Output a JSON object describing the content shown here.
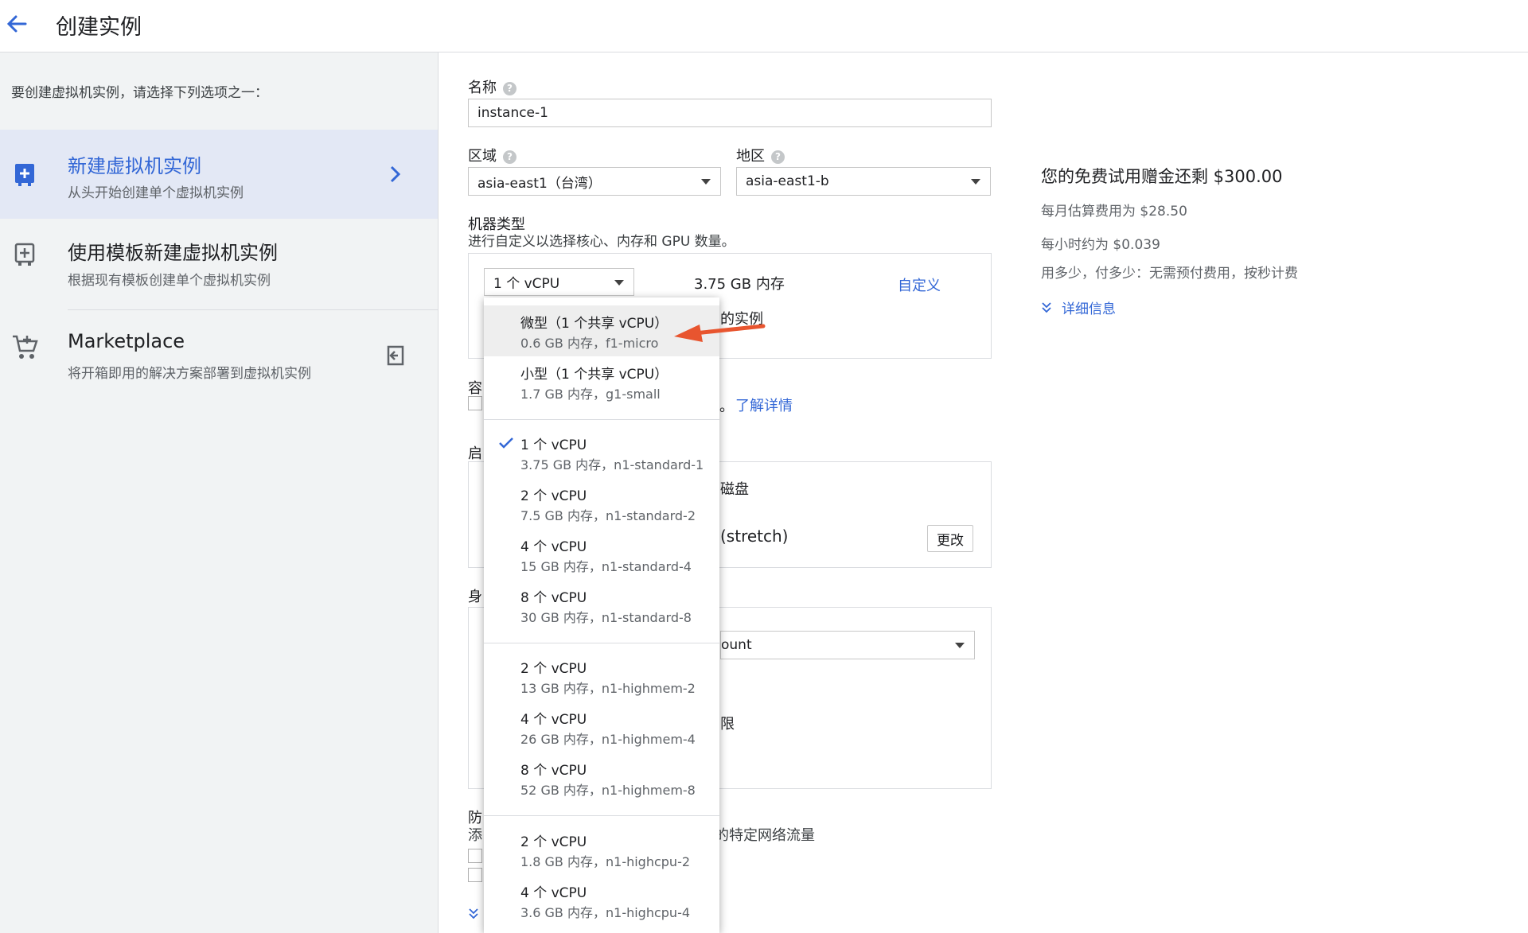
{
  "header": {
    "title": "创建实例",
    "back_icon": "arrow-back-icon"
  },
  "sidebar": {
    "intro": "要创建虚拟机实例，请选择下列选项之一：",
    "options": [
      {
        "title": "新建虚拟机实例",
        "subtitle": "从头开始创建单个虚拟机实例",
        "icon": "add-instance-icon",
        "selected": true
      },
      {
        "title": "使用模板新建虚拟机实例",
        "subtitle": "根据现有模板创建单个虚拟机实例",
        "icon": "add-template-icon",
        "selected": false
      },
      {
        "title": "Marketplace",
        "subtitle": "将开箱即用的解决方案部署到虚拟机实例",
        "icon": "cart-icon",
        "selected": false
      }
    ]
  },
  "form": {
    "name": {
      "label": "名称",
      "value": "instance-1"
    },
    "region": {
      "label": "区域",
      "value": "asia-east1（台湾）"
    },
    "zone": {
      "label": "地区",
      "value": "asia-east1-b"
    },
    "machine_type": {
      "label": "机器类型",
      "hint": "进行自定义以选择核心、内存和 GPU 数量。",
      "selected": "1 个 vCPU",
      "memory": "3.75 GB 内存",
      "customize": "自定义",
      "partial_text": "的实例"
    },
    "frag_container": "容",
    "frag_learn_prefix": "。",
    "learn_more": "了解详情",
    "frag_boot": "启",
    "frag_disk": "磁盘",
    "frag_stretch": "(stretch)",
    "change_button": "更改",
    "frag_identity": "身",
    "frag_account": "ount",
    "frag_limit": "限",
    "frag_firewall": "防",
    "frag_add": "添",
    "frag_traffic": "的特定网络流量"
  },
  "dropdown": {
    "items": [
      {
        "title": "微型（1 个共享 vCPU）",
        "subtitle": "0.6 GB 内存，f1-micro",
        "highlighted": true
      },
      {
        "title": "小型（1 个共享 vCPU）",
        "subtitle": "1.7 GB 内存，g1-small"
      },
      {
        "title": "1 个 vCPU",
        "subtitle": "3.75 GB 内存，n1-standard-1",
        "checked": true
      },
      {
        "title": "2 个 vCPU",
        "subtitle": "7.5 GB 内存，n1-standard-2"
      },
      {
        "title": "4 个 vCPU",
        "subtitle": "15 GB 内存，n1-standard-4"
      },
      {
        "title": "8 个 vCPU",
        "subtitle": "30 GB 内存，n1-standard-8"
      },
      {
        "title": "2 个 vCPU",
        "subtitle": "13 GB 内存，n1-highmem-2"
      },
      {
        "title": "4 个 vCPU",
        "subtitle": "26 GB 内存，n1-highmem-4"
      },
      {
        "title": "8 个 vCPU",
        "subtitle": "52 GB 内存，n1-highmem-8"
      },
      {
        "title": "2 个 vCPU",
        "subtitle": "1.8 GB 内存，n1-highcpu-2"
      },
      {
        "title": "4 个 vCPU",
        "subtitle": "3.6 GB 内存，n1-highcpu-4"
      }
    ]
  },
  "pricing": {
    "title": "您的免费试用赠金还剩 $300.00",
    "monthly": "每月估算费用为 $28.50",
    "hourly": "每小时约为 $0.039",
    "note": "用多少，付多少：无需预付费用，按秒计费",
    "details": "详细信息"
  },
  "colors": {
    "accent": "#3367d6",
    "arrow": "#e8552f",
    "selected_bg": "#e3e8f5",
    "sidebar_bg": "#f1f3f4"
  }
}
